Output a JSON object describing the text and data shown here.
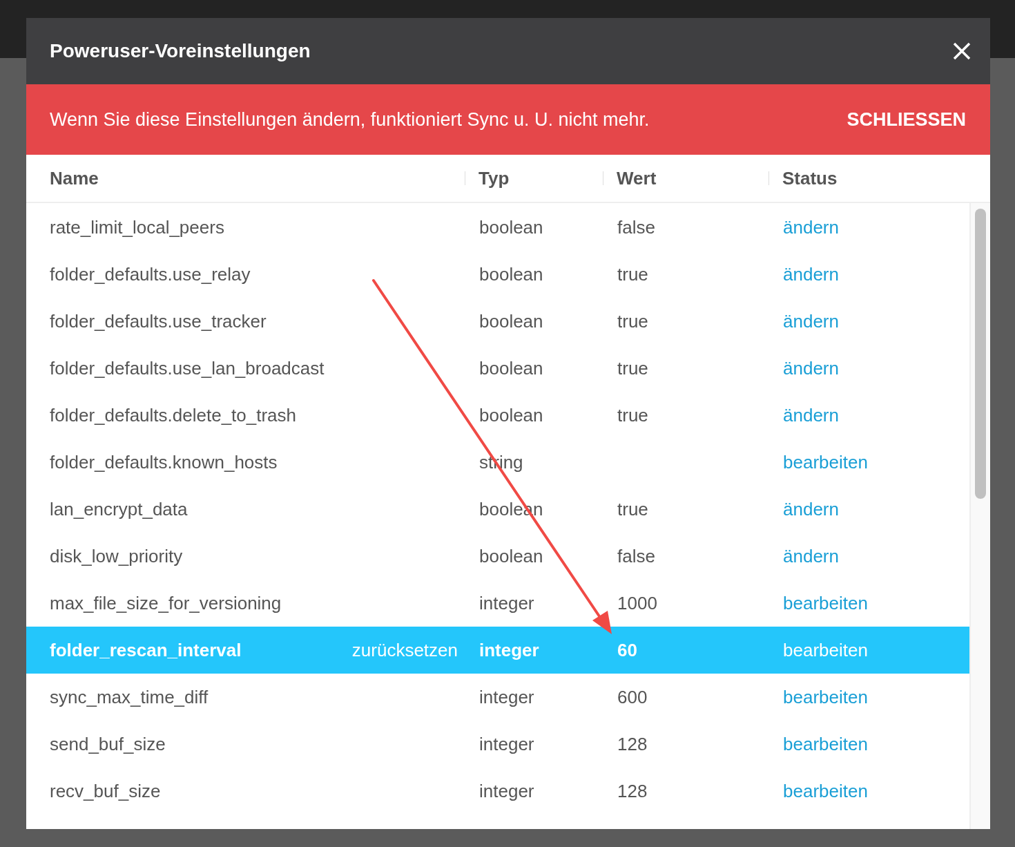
{
  "dialog": {
    "title": "Poweruser-Voreinstellungen"
  },
  "banner": {
    "message": "Wenn Sie diese Einstellungen ändern, funktioniert Sync u. U. nicht mehr.",
    "dismiss": "SCHLIESSEN"
  },
  "table": {
    "columns": [
      "Name",
      "Typ",
      "Wert",
      "Status"
    ],
    "rows": [
      {
        "name": "rate_limit_local_peers",
        "type": "boolean",
        "value": "false",
        "action": "ändern",
        "selected": false
      },
      {
        "name": "folder_defaults.use_relay",
        "type": "boolean",
        "value": "true",
        "action": "ändern",
        "selected": false
      },
      {
        "name": "folder_defaults.use_tracker",
        "type": "boolean",
        "value": "true",
        "action": "ändern",
        "selected": false
      },
      {
        "name": "folder_defaults.use_lan_broadcast",
        "type": "boolean",
        "value": "true",
        "action": "ändern",
        "selected": false
      },
      {
        "name": "folder_defaults.delete_to_trash",
        "type": "boolean",
        "value": "true",
        "action": "ändern",
        "selected": false
      },
      {
        "name": "folder_defaults.known_hosts",
        "type": "string",
        "action": "bearbeiten",
        "selected": false
      },
      {
        "name": "lan_encrypt_data",
        "type": "boolean",
        "value": "true",
        "action": "ändern",
        "selected": false
      },
      {
        "name": "disk_low_priority",
        "type": "boolean",
        "value": "false",
        "action": "ändern",
        "selected": false
      },
      {
        "name": "max_file_size_for_versioning",
        "type": "integer",
        "value": "1000",
        "action": "bearbeiten",
        "selected": false
      },
      {
        "name": "folder_rescan_interval",
        "reset": "zurücksetzen",
        "type": "integer",
        "value": "60",
        "action": "bearbeiten",
        "selected": true
      },
      {
        "name": "sync_max_time_diff",
        "type": "integer",
        "value": "600",
        "action": "bearbeiten",
        "selected": false
      },
      {
        "name": "send_buf_size",
        "type": "integer",
        "value": "128",
        "action": "bearbeiten",
        "selected": false
      },
      {
        "name": "recv_buf_size",
        "type": "integer",
        "value": "128",
        "action": "bearbeiten",
        "selected": false
      }
    ]
  }
}
